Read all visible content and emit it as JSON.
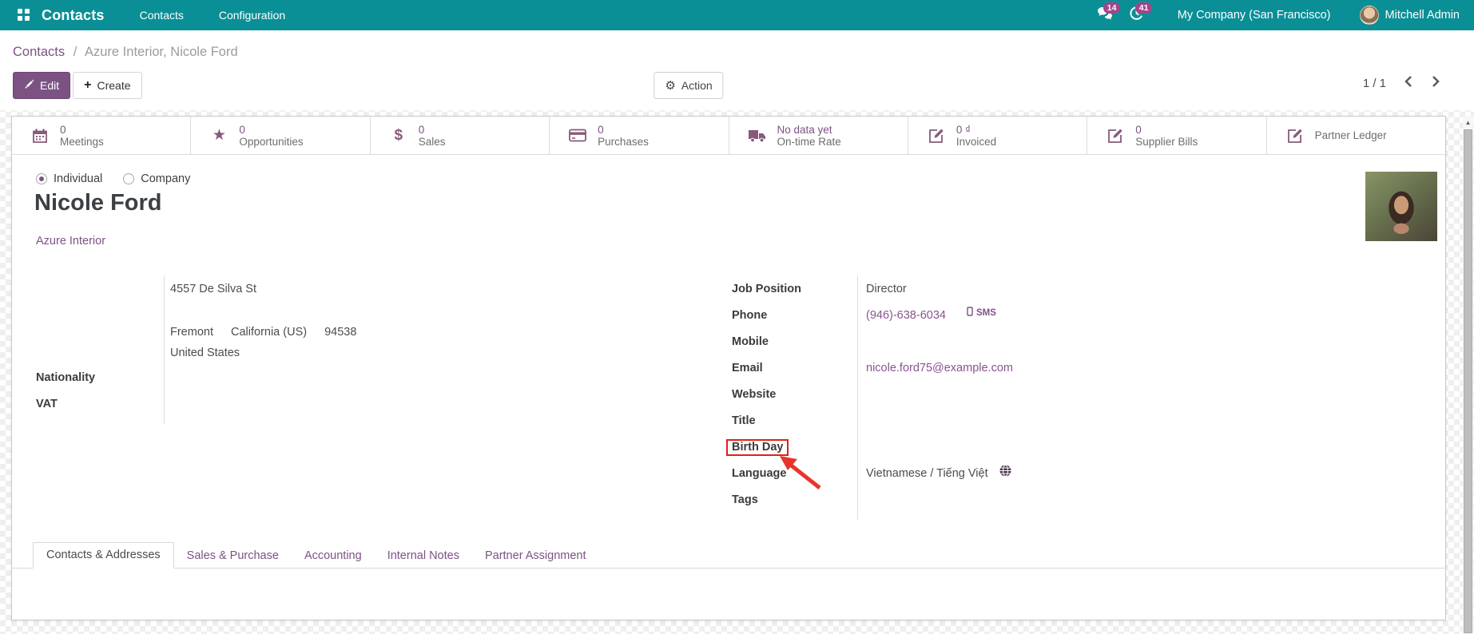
{
  "nav": {
    "app_name": "Contacts",
    "menu_contacts": "Contacts",
    "menu_configuration": "Configuration",
    "messages_badge": "14",
    "activities_badge": "41",
    "company": "My Company (San Francisco)",
    "user": "Mitchell Admin"
  },
  "cp": {
    "breadcrumb_root": "Contacts",
    "breadcrumb_sep": "/",
    "breadcrumb_current": "Azure Interior, Nicole Ford",
    "edit": "Edit",
    "create": "Create",
    "action": "Action",
    "pager": "1 / 1"
  },
  "stats": [
    {
      "icon": "calendar-icon",
      "value": "0",
      "label": "Meetings"
    },
    {
      "icon": "star-icon",
      "value": "0",
      "label": "Opportunities"
    },
    {
      "icon": "dollar-icon",
      "value": "0",
      "label": "Sales"
    },
    {
      "icon": "credit-card-icon",
      "value": "0",
      "label": "Purchases"
    },
    {
      "icon": "truck-icon",
      "value": "No data yet",
      "label": "On-time Rate"
    },
    {
      "icon": "edit-note-icon",
      "value": "0 ₫",
      "label": "Invoiced"
    },
    {
      "icon": "edit-note-icon",
      "value": "0",
      "label": "Supplier Bills"
    },
    {
      "icon": "edit-note-icon",
      "value": "",
      "label": "Partner Ledger"
    }
  ],
  "form": {
    "radio_individual": "Individual",
    "radio_company": "Company",
    "name": "Nicole Ford",
    "company_link": "Azure Interior",
    "address": {
      "street": "4557 De Silva St",
      "city": "Fremont",
      "state": "California (US)",
      "zip": "94538",
      "country": "United States"
    },
    "labels": {
      "nationality": "Nationality",
      "vat": "VAT"
    },
    "rows": [
      {
        "label": "Job Position",
        "value": "Director"
      },
      {
        "label": "Phone",
        "value": "(946)-638-6034",
        "sms": "SMS"
      },
      {
        "label": "Mobile",
        "value": ""
      },
      {
        "label": "Email",
        "value": "nicole.ford75@example.com"
      },
      {
        "label": "Website",
        "value": ""
      },
      {
        "label": "Title",
        "value": ""
      },
      {
        "label": "Birth Day",
        "value": ""
      },
      {
        "label": "Language",
        "value": "Vietnamese / Tiếng Việt"
      },
      {
        "label": "Tags",
        "value": ""
      }
    ]
  },
  "tabs": [
    {
      "label": "Contacts & Addresses"
    },
    {
      "label": "Sales & Purchase"
    },
    {
      "label": "Accounting"
    },
    {
      "label": "Internal Notes"
    },
    {
      "label": "Partner Assignment"
    }
  ],
  "colors": {
    "navbar_teal": "#0a8f96",
    "primary_purple": "#7c5283",
    "icon_purple": "#875a7b",
    "badge_magenta": "#a24689",
    "highlight_red": "#e0201d"
  }
}
